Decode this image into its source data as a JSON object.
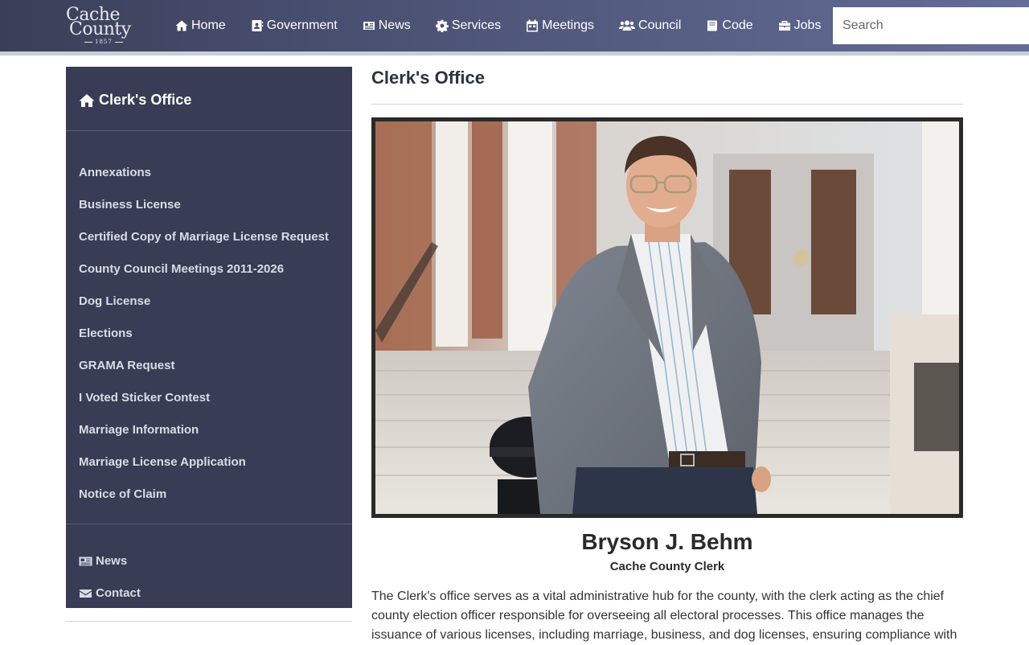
{
  "logo": {
    "line1": "Cache",
    "line2": "County",
    "year": "1857"
  },
  "nav": {
    "items": [
      {
        "label": "Home",
        "icon": "home-icon"
      },
      {
        "label": "Government",
        "icon": "address-book-icon"
      },
      {
        "label": "News",
        "icon": "newspaper-icon"
      },
      {
        "label": "Services",
        "icon": "gear-icon"
      },
      {
        "label": "Meetings",
        "icon": "calendar-icon"
      },
      {
        "label": "Council",
        "icon": "users-icon"
      },
      {
        "label": "Code",
        "icon": "book-icon"
      },
      {
        "label": "Jobs",
        "icon": "briefcase-icon"
      }
    ],
    "search_placeholder": "Search"
  },
  "sidebar": {
    "title": "Clerk's Office",
    "links": [
      "Annexations",
      "Business License",
      "Certified Copy of Marriage License Request",
      "County Council Meetings 2011-2026",
      "Dog License",
      "Elections",
      "GRAMA Request",
      "I Voted Sticker Contest",
      "Marriage Information",
      "Marriage License Application",
      "Notice of Claim"
    ],
    "footer": [
      {
        "label": "News",
        "icon": "newspaper-icon"
      },
      {
        "label": "Contact",
        "icon": "envelope-icon"
      }
    ]
  },
  "main": {
    "title": "Clerk's Office",
    "person": {
      "name": "Bryson J. Behm",
      "role": "Cache County Clerk"
    },
    "description": "The Clerk's office serves as a vital administrative hub for the county, with the clerk acting as the chief county election officer responsible for overseeing all electoral processes. This office manages the issuance of various licenses, including marriage, business, and dog licenses, ensuring compliance with"
  },
  "colors": {
    "nav_gradient_start": "#3a3f58",
    "nav_gradient_end": "#646d98",
    "sidebar_bg": "#383d55",
    "title_text": "#2e3142"
  }
}
